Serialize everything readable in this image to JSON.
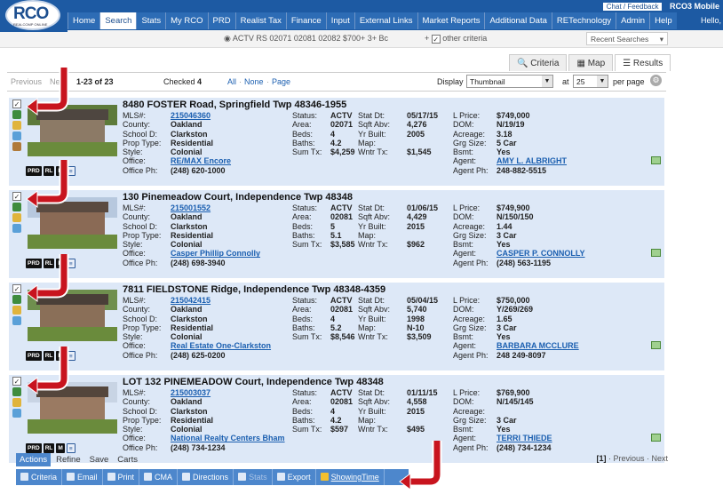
{
  "app": {
    "logo": "RCO",
    "logo_sub": "REALCOMP ONLINE",
    "chat": "Chat / Feedback",
    "mobile": "RCO3 Mobile",
    "hello": "Hello,"
  },
  "nav": [
    "Home",
    "Search",
    "Stats",
    "My RCO",
    "PRD",
    "Realist Tax",
    "Finance",
    "Input",
    "External Links",
    "Market Reports",
    "Additional Data",
    "RETechnology",
    "Admin",
    "Help"
  ],
  "criteria": {
    "summary": "ACTV RS 02071 02081 02082 $700+ 3+ Bc",
    "other": "other criteria",
    "recent": "Recent Searches"
  },
  "view_tabs": [
    "Criteria",
    "Map",
    "Results"
  ],
  "results_bar": {
    "previous": "Previous",
    "next": "Ne",
    "range": "1-23 of 23",
    "checked_label": "Checked",
    "checked_count": "4",
    "all": "All",
    "none": "None",
    "page": "Page",
    "display_label": "Display",
    "display_value": "Thumbnail",
    "at_label": "at",
    "per_page": "25",
    "per_page_label": "per page"
  },
  "listings": [
    {
      "address": "8480 FOSTER Road, Springfield Twp 48346-1955",
      "mls": "215046360",
      "county": "Oakland",
      "school": "Clarkston",
      "prop_type": "Residential",
      "style": "Colonial",
      "office": "RE/MAX Encore",
      "office_ph": "(248) 620-1000",
      "status": "ACTV",
      "area": "02071",
      "beds": "4",
      "baths": "4.2",
      "sum_tx": "$4,259",
      "stat_dt": "05/17/15",
      "sqft": "4,276",
      "yr_built": "2005",
      "map": "",
      "wntr_tx": "$1,545",
      "l_price": "$749,000",
      "dom": "N/19/19",
      "acreage": "3.18",
      "grg": "5 Car",
      "bsmt": "Yes",
      "agent": "AMY L. ALBRIGHT",
      "agent_ph": "248-882-5515"
    },
    {
      "address": "130 Pinemeadow Court, Independence Twp 48348",
      "mls": "215001552",
      "county": "Oakland",
      "school": "Clarkston",
      "prop_type": "Residential",
      "style": "Colonial",
      "office": "Casper Phillip Connolly",
      "office_ph": "(248) 698-3940",
      "status": "ACTV",
      "area": "02081",
      "beds": "5",
      "baths": "5.1",
      "sum_tx": "$3,585",
      "stat_dt": "01/06/15",
      "sqft": "4,429",
      "yr_built": "2015",
      "map": "",
      "wntr_tx": "$962",
      "l_price": "$749,900",
      "dom": "N/150/150",
      "acreage": "1.44",
      "grg": "3 Car",
      "bsmt": "Yes",
      "agent": "CASPER P. CONNOLLY",
      "agent_ph": "(248) 563-1195"
    },
    {
      "address": "7811 FIELDSTONE Ridge, Independence Twp 48348-4359",
      "mls": "215042415",
      "county": "Oakland",
      "school": "Clarkston",
      "prop_type": "Residential",
      "style": "Colonial",
      "office": "Real Estate One-Clarkston",
      "office_ph": "(248) 625-0200",
      "status": "ACTV",
      "area": "02081",
      "beds": "4",
      "baths": "5.2",
      "sum_tx": "$8,546",
      "stat_dt": "05/04/15",
      "sqft": "5,740",
      "yr_built": "1998",
      "map": "N-10",
      "wntr_tx": "$3,509",
      "l_price": "$750,000",
      "dom": "Y/269/269",
      "acreage": "1.65",
      "grg": "3 Car",
      "bsmt": "Yes",
      "agent": "BARBARA MCCLURE",
      "agent_ph": "248 249-8097"
    },
    {
      "address": "LOT 132 PINEMEADOW Court, Independence Twp 48348",
      "mls": "215003037",
      "county": "Oakland",
      "school": "Clarkston",
      "prop_type": "Residential",
      "style": "Colonial",
      "office": "National Realty Centers Bham",
      "office_ph": "(248) 734-1234",
      "status": "ACTV",
      "area": "02081",
      "beds": "4",
      "baths": "4.2",
      "sum_tx": "$597",
      "stat_dt": "01/11/15",
      "sqft": "4,558",
      "yr_built": "2015",
      "map": "",
      "wntr_tx": "$495",
      "l_price": "$769,900",
      "dom": "N/145/145",
      "acreage": "",
      "grg": "3 Car",
      "bsmt": "Yes",
      "agent": "TERRI THIEDE",
      "agent_ph": "(248) 734-1234"
    }
  ],
  "labels": {
    "mls": "MLS#:",
    "county": "County:",
    "school": "School D:",
    "prop_type": "Prop Type:",
    "style": "Style:",
    "office": "Office:",
    "office_ph": "Office Ph:",
    "status": "Status:",
    "area": "Area:",
    "beds": "Beds:",
    "baths": "Baths:",
    "sum_tx": "Sum Tx:",
    "stat_dt": "Stat Dt:",
    "sqft": "Sqft Abv:",
    "yr_built": "Yr Built:",
    "map": "Map:",
    "wntr_tx": "Wntr Tx:",
    "l_price": "L Price:",
    "dom": "DOM:",
    "acreage": "Acreage:",
    "grg": "Grg Size:",
    "bsmt": "Bsmt:",
    "agent": "Agent:",
    "agent_ph": "Agent Ph:"
  },
  "tool_labels": [
    "PRD",
    "RL",
    "M"
  ],
  "actions": {
    "tabs": [
      "Actions",
      "Refine",
      "Save",
      "Carts"
    ],
    "pager_page": "[1]",
    "pager_prev": "Previous",
    "pager_next": "Next",
    "buttons": [
      "Criteria",
      "Email",
      "Print",
      "CMA",
      "Directions",
      "Stats",
      "Export",
      "ShowingTime"
    ]
  },
  "colors": {
    "nav_bg": "#1d5aa3",
    "card_bg": "#dde8f7",
    "arrow": "#c8141e",
    "action_bar": "#4d87cc"
  }
}
